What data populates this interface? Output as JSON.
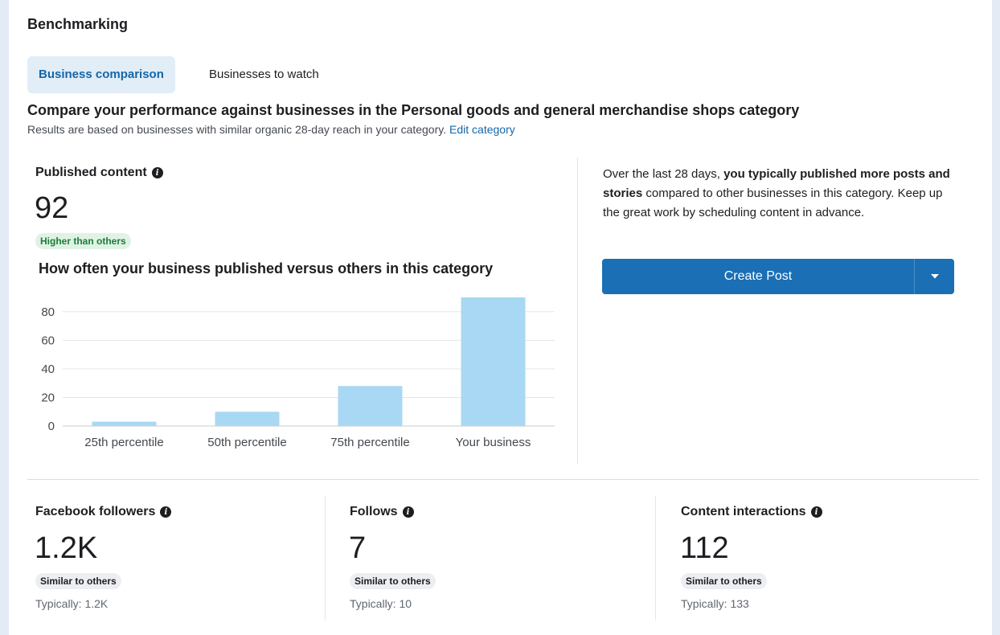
{
  "section_title": "Benchmarking",
  "tabs": [
    {
      "label": "Business comparison",
      "active": true
    },
    {
      "label": "Businesses to watch",
      "active": false
    }
  ],
  "heading": "Compare your performance against businesses in the Personal goods and general merchandise shops category",
  "subtext": "Results are based on businesses with similar organic 28-day reach in your category.",
  "edit_link": "Edit category",
  "published": {
    "label": "Published content",
    "value": "92",
    "badge": "Higher than others"
  },
  "chart_title": "How often your business published versus others in this category",
  "chart_data": {
    "type": "bar",
    "categories": [
      "25th percentile",
      "50th percentile",
      "75th percentile",
      "Your business"
    ],
    "values": [
      3,
      10,
      28,
      92
    ],
    "ylim": [
      0,
      90
    ],
    "yticks": [
      0,
      20,
      40,
      60,
      80
    ],
    "grid": true,
    "bar_color": "#a8d8f3"
  },
  "insight": {
    "prefix": "Over the last 28 days,",
    "bold": "you typically published more posts and stories",
    "suffix": "compared to other businesses in this category. Keep up the great work by scheduling content in advance."
  },
  "cta": {
    "label": "Create Post",
    "dropdown_icon": "caret-down-icon"
  },
  "metrics": [
    {
      "label": "Facebook followers",
      "value": "1.2K",
      "badge": "Similar to others",
      "typical": "Typically: 1.2K"
    },
    {
      "label": "Follows",
      "value": "7",
      "badge": "Similar to others",
      "typical": "Typically: 10"
    },
    {
      "label": "Content interactions",
      "value": "112",
      "badge": "Similar to others",
      "typical": "Typically: 133"
    }
  ],
  "colors": {
    "accent": "#1a6fb5",
    "tab_active_bg": "#e1edf7",
    "badge_green_bg": "#dff3e5"
  }
}
